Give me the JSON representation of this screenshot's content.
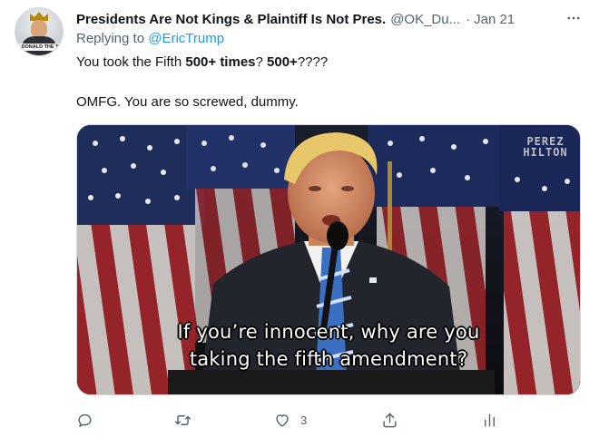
{
  "tweet": {
    "author_name": "Presidents Are Not Kings & Plaintiff Is Not Pres.",
    "author_handle": "@OK_Du...",
    "separator": "·",
    "date": "Jan 21",
    "avatar_label": "DONALD THE T",
    "replying_prefix": "Replying to",
    "replying_to": "@EricTrump",
    "line1_a": "You took the Fifth ",
    "line1_b": "500+ times",
    "line1_c": "?  ",
    "line1_d": "500+",
    "line1_e": "????",
    "line2": "OMFG.  You are so screwed, dummy.",
    "media": {
      "subtitle_line1": "If you’re innocent, why are you",
      "subtitle_line2": "taking the fifth amendment?",
      "watermark_line1": "PEREZ",
      "watermark_line2": "HILTON"
    },
    "actions": {
      "reply_count": "",
      "retweet_count": "",
      "like_count": "3",
      "share_label": "",
      "analytics_label": ""
    }
  },
  "icons": [
    "more-icon",
    "reply-icon",
    "retweet-icon",
    "like-icon",
    "share-icon",
    "analytics-icon"
  ],
  "colors": {
    "link": "#1d9bf0",
    "secondary_text": "#536471",
    "primary_text": "#0f1419"
  }
}
